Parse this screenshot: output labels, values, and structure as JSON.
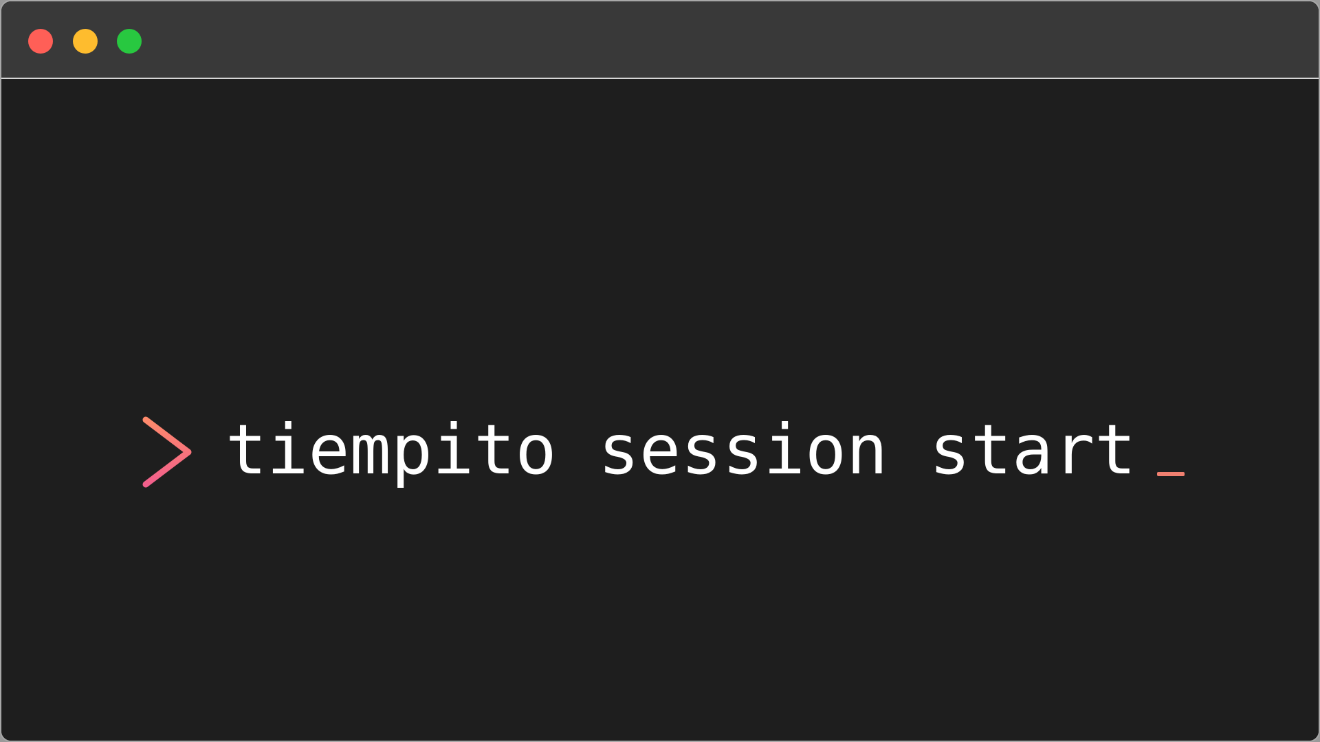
{
  "window": {
    "traffic_lights": {
      "close_color": "#ff5f57",
      "minimize_color": "#febc2e",
      "maximize_color": "#28c840"
    }
  },
  "terminal": {
    "prompt_icon": "chevron-right-icon",
    "prompt_gradient": [
      "#ff8a6b",
      "#f25f8c"
    ],
    "command": "tiempito session start",
    "cursor_color": "#f08070"
  }
}
